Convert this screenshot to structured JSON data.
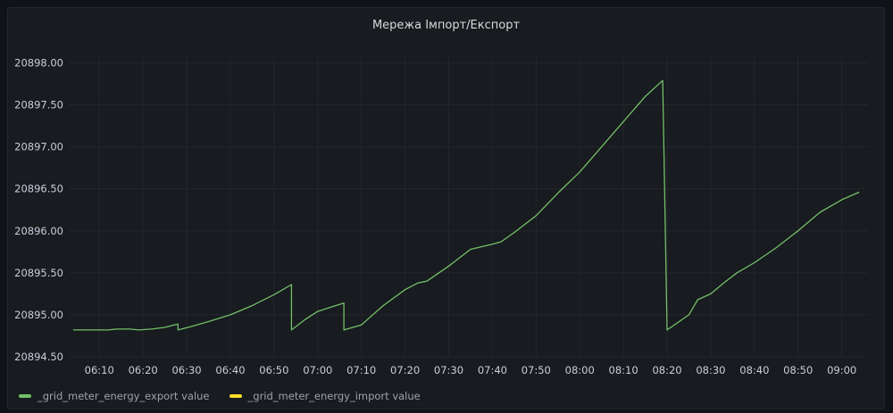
{
  "panel": {
    "title": "Мережа Імпорт/Експорт"
  },
  "colors": {
    "export": "#73bf69",
    "import": "#fade2a",
    "grid": "#24262b",
    "tick_text": "#ccccdc"
  },
  "chart_data": {
    "type": "line",
    "title": "Мережа Імпорт/Експорт",
    "xlabel": "",
    "ylabel": "",
    "x_unit": "time (HH:MM)",
    "xlim": [
      "06:03",
      "09:06"
    ],
    "ylim": [
      20894.5,
      20898.1
    ],
    "grid": true,
    "legend_position": "bottom-left",
    "x_ticks": [
      "06:10",
      "06:20",
      "06:30",
      "06:40",
      "06:50",
      "07:00",
      "07:10",
      "07:20",
      "07:30",
      "07:40",
      "07:50",
      "08:00",
      "08:10",
      "08:20",
      "08:30",
      "08:40",
      "08:50",
      "09:00"
    ],
    "y_ticks": [
      "20894.50",
      "20895.00",
      "20895.50",
      "20896.00",
      "20896.50",
      "20897.00",
      "20897.50",
      "20898.00"
    ],
    "series": [
      {
        "name": "_grid_meter_energy_export value",
        "color": "#73bf69",
        "points": [
          [
            "06:04",
            20894.82
          ],
          [
            "06:12",
            20894.82
          ],
          [
            "06:14",
            20894.83
          ],
          [
            "06:17",
            20894.83
          ],
          [
            "06:19",
            20894.82
          ],
          [
            "06:22",
            20894.83
          ],
          [
            "06:25",
            20894.85
          ],
          [
            "06:28",
            20894.89
          ],
          [
            "06:28",
            20894.82
          ],
          [
            "06:31",
            20894.86
          ],
          [
            "06:35",
            20894.92
          ],
          [
            "06:40",
            20895.0
          ],
          [
            "06:45",
            20895.11
          ],
          [
            "06:50",
            20895.24
          ],
          [
            "06:54",
            20895.36
          ],
          [
            "06:54",
            20894.82
          ],
          [
            "06:57",
            20894.94
          ],
          [
            "07:00",
            20895.04
          ],
          [
            "07:03",
            20895.09
          ],
          [
            "07:06",
            20895.14
          ],
          [
            "07:06",
            20894.82
          ],
          [
            "07:10",
            20894.88
          ],
          [
            "07:15",
            20895.11
          ],
          [
            "07:20",
            20895.3
          ],
          [
            "07:23",
            20895.38
          ],
          [
            "07:25",
            20895.4
          ],
          [
            "07:30",
            20895.58
          ],
          [
            "07:35",
            20895.78
          ],
          [
            "07:40",
            20895.84
          ],
          [
            "07:42",
            20895.87
          ],
          [
            "07:45",
            20895.98
          ],
          [
            "07:50",
            20896.18
          ],
          [
            "07:55",
            20896.45
          ],
          [
            "08:00",
            20896.7
          ],
          [
            "08:05",
            20897.0
          ],
          [
            "08:10",
            20897.3
          ],
          [
            "08:15",
            20897.6
          ],
          [
            "08:19",
            20897.79
          ],
          [
            "08:20",
            20894.82
          ],
          [
            "08:25",
            20895.0
          ],
          [
            "08:27",
            20895.18
          ],
          [
            "08:30",
            20895.25
          ],
          [
            "08:33",
            20895.38
          ],
          [
            "08:36",
            20895.5
          ],
          [
            "08:40",
            20895.62
          ],
          [
            "08:45",
            20895.8
          ],
          [
            "08:50",
            20896.0
          ],
          [
            "08:55",
            20896.22
          ],
          [
            "09:00",
            20896.37
          ],
          [
            "09:04",
            20896.46
          ]
        ]
      },
      {
        "name": "_grid_meter_energy_import value",
        "color": "#fade2a",
        "points": []
      }
    ]
  }
}
